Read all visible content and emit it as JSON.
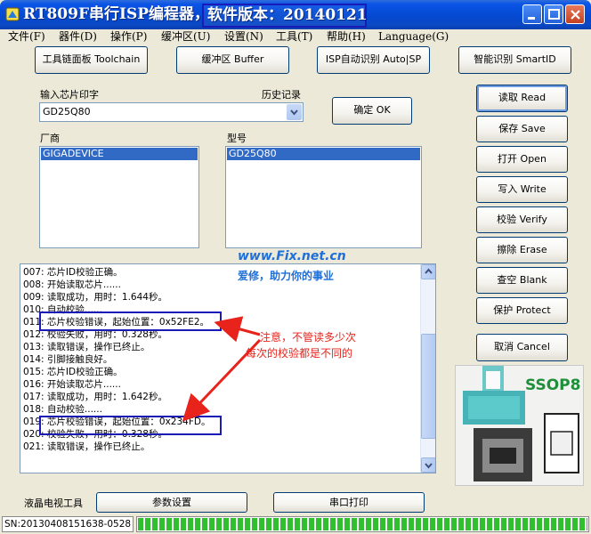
{
  "window": {
    "title": "RT809F串行ISP编程器，",
    "version_label": "软件版本：20140121"
  },
  "menu": [
    "文件(F)",
    "器件(D)",
    "操作(P)",
    "缓冲区(U)",
    "设置(N)",
    "工具(T)",
    "帮助(H)",
    "Language(G)"
  ],
  "toolbar": {
    "toolchain": "工具链面板 Toolchain",
    "buffer": "缓冲区 Buffer",
    "auto_isp": "ISP自动识别 Auto|SP",
    "smart_id": "智能识别 SmartID"
  },
  "chip": {
    "input_label": "输入芯片印字",
    "history_label": "历史记录",
    "input_value": "GD25Q80",
    "ok_button": "确定 OK"
  },
  "vendor": {
    "label": "厂商",
    "selected": "GIGADEVICE"
  },
  "model": {
    "label": "型号",
    "selected": "GD25Q80"
  },
  "actions": {
    "read": "读取 Read",
    "save": "保存 Save",
    "open": "打开 Open",
    "write": "写入 Write",
    "verify": "校验 Verify",
    "erase": "擦除 Erase",
    "blank": "查空 Blank",
    "protect": "保护 Protect",
    "cancel": "取消 Cancel"
  },
  "log": [
    "007: 芯片ID校验正确。",
    "008: 开始读取芯片......",
    "009: 读取成功，用时：1.644秒。",
    "010: 自动校验......",
    "011: 芯片校验错误，起始位置：0x52FE2。",
    "012: 校验失败，用时：0.328秒。",
    "013: 读取错误，操作已终止。",
    "014: 引脚接触良好。",
    "015: 芯片ID校验正确。",
    "016: 开始读取芯片......",
    "017: 读取成功，用时：1.642秒。",
    "018: 自动校验......",
    "019: 芯片校验错误，起始位置：0x234FD。",
    "020: 校验失败，用时：0.328秒。",
    "021: 读取错误，操作已终止。"
  ],
  "watermark": {
    "site": "www.Fix.net.cn",
    "slogan": "爱修，助力你的事业"
  },
  "annotation": {
    "line1": "注意，不管读多少次",
    "line2": "每次的校验都是不同的"
  },
  "package": {
    "label": "SSOP8"
  },
  "bottom": {
    "lcd_label": "液晶电视工具",
    "params_button": "参数设置",
    "serial_button": "串口打印"
  },
  "status": {
    "sn": "SN:20130408151638-0528",
    "progress": 1.0
  },
  "colors": {
    "highlight_box": "#1a1ab8",
    "annotation_red": "#e8231b",
    "watermark_blue": "#1e6fd9",
    "progress_green": "#2fbf2f"
  }
}
